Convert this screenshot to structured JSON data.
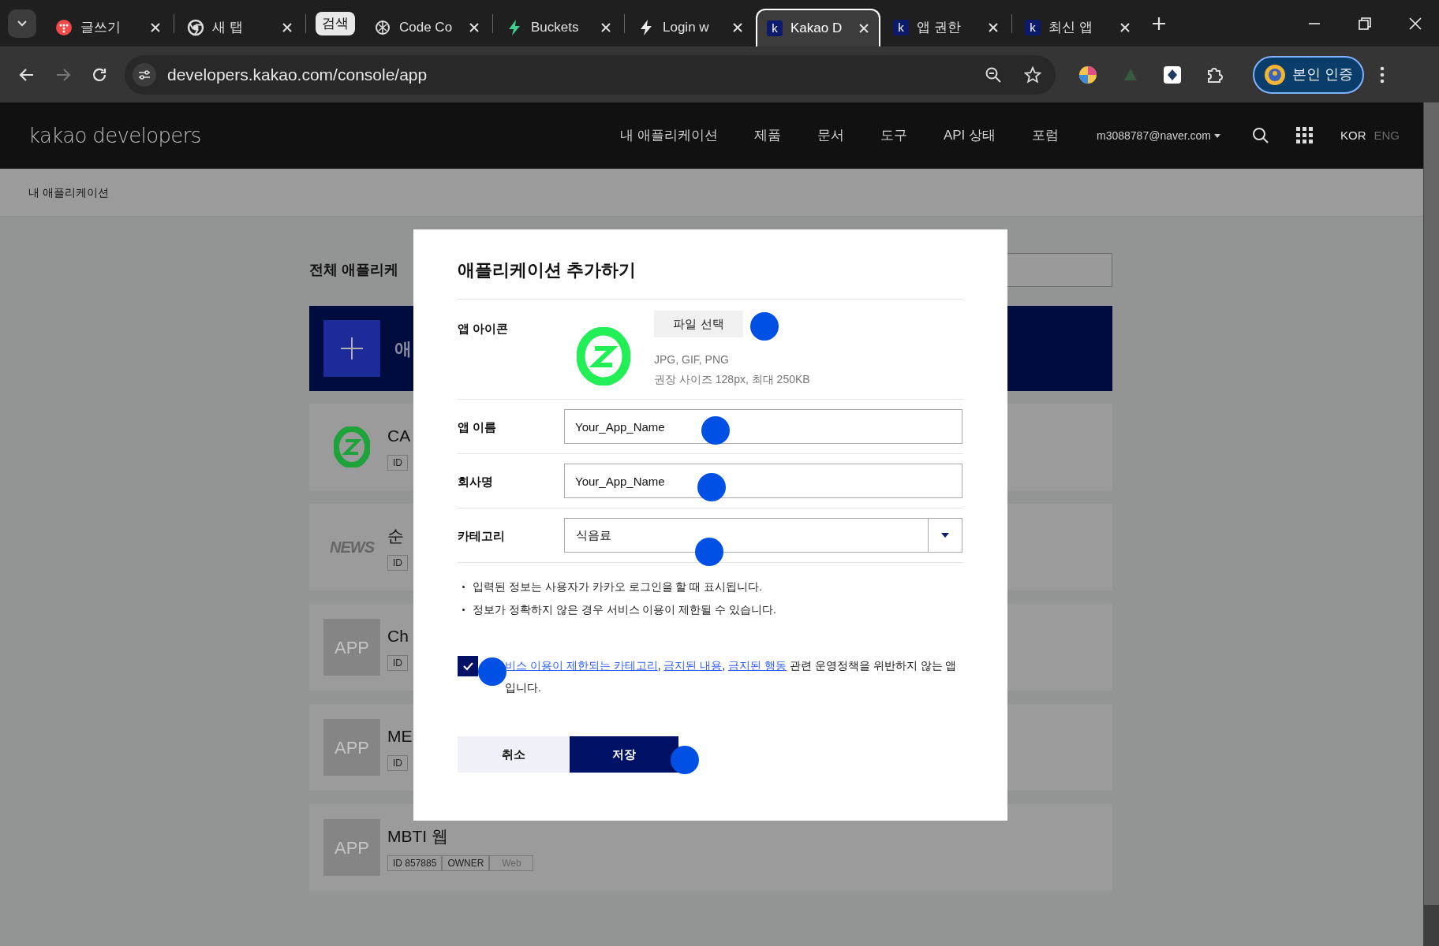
{
  "browser": {
    "tabs": [
      {
        "kind": "tab",
        "title": "글쓰기",
        "selected": false
      },
      {
        "kind": "tab",
        "title": "새 탭",
        "selected": false
      },
      {
        "kind": "chip",
        "title": "검색",
        "selected": false
      },
      {
        "kind": "tab",
        "title": "Code Co",
        "selected": false
      },
      {
        "kind": "tab",
        "title": "Buckets",
        "selected": false
      },
      {
        "kind": "tab",
        "title": "Login w",
        "selected": false
      },
      {
        "kind": "tab",
        "icon_text": "k",
        "title": "Kakao D",
        "selected": true
      },
      {
        "kind": "tab",
        "icon_text": "k",
        "title": "앱 권한",
        "selected": false
      },
      {
        "kind": "tab",
        "icon_text": "k",
        "title": "최신 앱",
        "selected": false
      }
    ],
    "url": "developers.kakao.com/console/app",
    "profile_button": "본인 인증"
  },
  "header": {
    "logo": "kakao developers",
    "nav": [
      "내 애플리케이션",
      "제품",
      "문서",
      "도구",
      "API 상태",
      "포럼"
    ],
    "account": "m3088787@naver.com",
    "languages": [
      {
        "label": "KOR",
        "selected": true
      },
      {
        "label": "ENG",
        "selected": false
      }
    ]
  },
  "breadcrumb": "내 애플리케이션",
  "app_list": {
    "title": "전체 애플리케",
    "add_card_label": "애",
    "apps": [
      {
        "kind": "logo",
        "name": "CA",
        "tags": [
          "ID"
        ]
      },
      {
        "kind": "news",
        "icon_text": "NEWS",
        "name": "순",
        "tags": [
          "ID"
        ]
      },
      {
        "kind": "placeholder",
        "icon_text": "APP",
        "name": "Ch",
        "tags": [
          "ID"
        ]
      },
      {
        "kind": "placeholder",
        "icon_text": "APP",
        "name": "ME",
        "tags": [
          "ID"
        ]
      },
      {
        "kind": "placeholder",
        "icon_text": "APP",
        "name": "MBTI 웹",
        "tags": [
          "ID 857885",
          "OWNER",
          "Web"
        ]
      }
    ]
  },
  "modal": {
    "title": "애플리케이션 추가하기",
    "rows": [
      {
        "kind": "icon",
        "label": "앱 아이콘",
        "button": "파일 선택",
        "hints": [
          "JPG, GIF, PNG",
          "권장 사이즈 128px, 최대 250KB"
        ]
      },
      {
        "kind": "input",
        "label": "앱 이름",
        "value": "Your_App_Name"
      },
      {
        "kind": "input",
        "label": "회사명",
        "value": "Your_App_Name"
      },
      {
        "kind": "select",
        "label": "카테고리",
        "value": "식음료"
      }
    ],
    "notes": [
      "입력된 정보는 사용자가 카카오 로그인을 할 때 표시됩니다.",
      "정보가 정확하지 않은 경우 서비스 이용이 제한될 수 있습니다."
    ],
    "agreement": {
      "checked": true,
      "parts": [
        {
          "kind": "link",
          "text": "비스 이용이 제한되는 카테고리"
        },
        {
          "kind": "text",
          "text": ", "
        },
        {
          "kind": "link",
          "text": "금지된 내용"
        },
        {
          "kind": "text",
          "text": ", "
        },
        {
          "kind": "link",
          "text": "금지된 행동"
        },
        {
          "kind": "text",
          "text": " 관련 운영정책을 위반하지 않는 앱입니다."
        }
      ]
    },
    "buttons": {
      "cancel": "취소",
      "save": "저장"
    }
  }
}
